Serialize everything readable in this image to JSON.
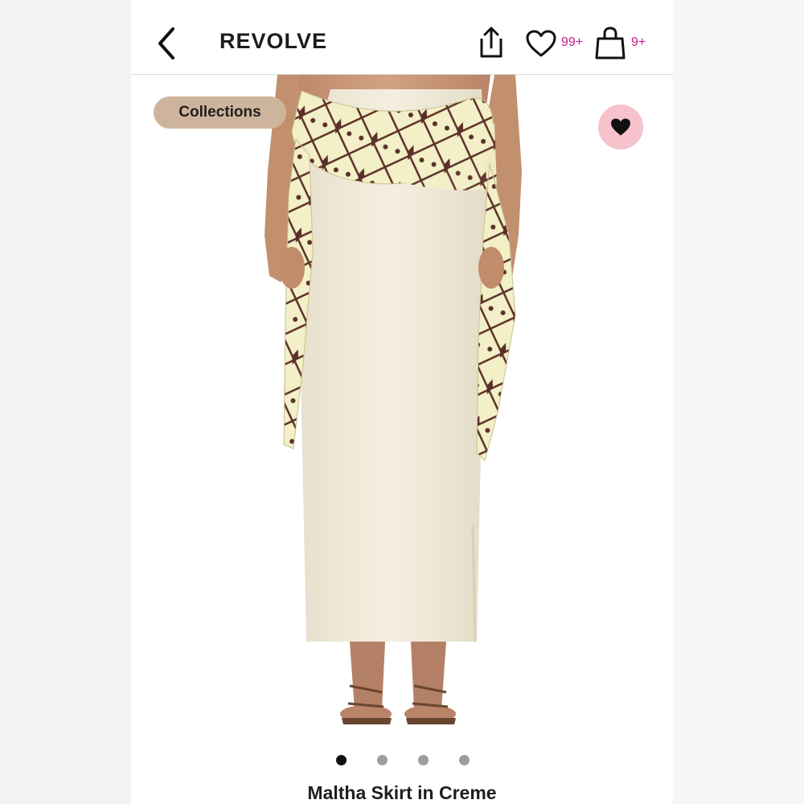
{
  "header": {
    "brand": "REVOLVE",
    "wishlist_count": "99+",
    "bag_count": "9+"
  },
  "icons": {
    "back": "chevron-left-icon",
    "share": "share-icon",
    "wishlist": "heart-outline-icon",
    "bag": "shopping-bag-icon",
    "favorite": "heart-filled-icon"
  },
  "colors": {
    "badge_text": "#c51f8e",
    "chip_bg": "#cfb49d",
    "fav_bg": "#f6c2cc",
    "skirt": "#efe9d8",
    "scarf_print": "#5b2f2a"
  },
  "gallery": {
    "collections_label": "Collections",
    "total_images": 4,
    "active_index": 0
  },
  "product": {
    "title": "Maltha Skirt in Creme"
  }
}
